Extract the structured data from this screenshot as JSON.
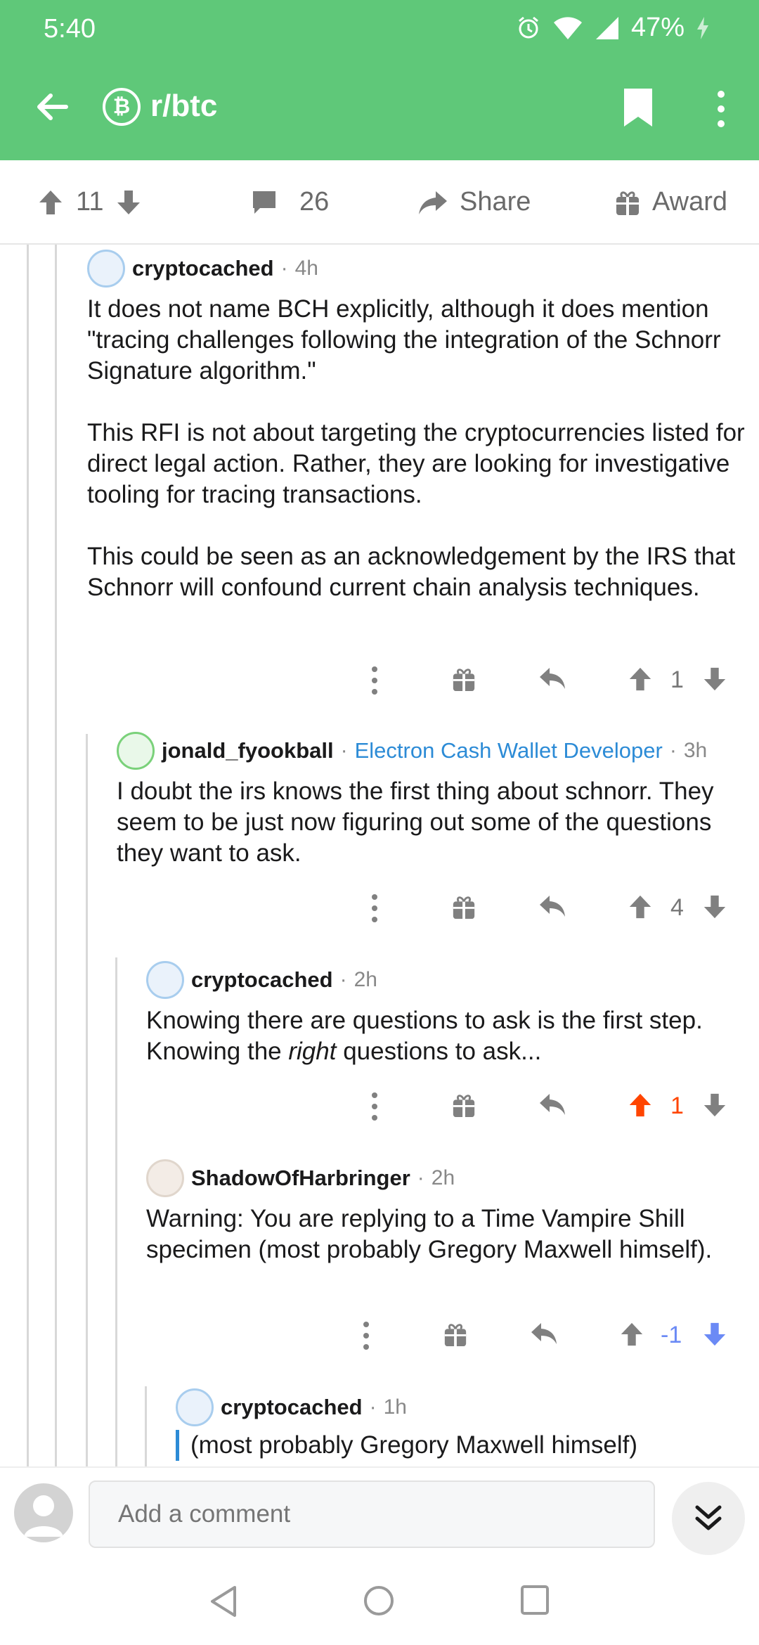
{
  "status": {
    "time": "5:40",
    "battery": "47%"
  },
  "app": {
    "subreddit": "r/btc",
    "sub_icon": "₿"
  },
  "post_actions": {
    "score": "11",
    "comments": "26",
    "share": "Share",
    "award": "Award"
  },
  "comments": [
    {
      "user": "cryptocached",
      "age": "4h",
      "paragraphs": [
        "It does not name BCH explicitly, although it does mention \"tracing challenges following the integration of the Schnorr Signature algorithm.\"",
        "This RFI is not about targeting the cryptocurrencies listed for direct legal action. Rather, they are looking for investigative tooling for tracing transactions.",
        "This could be seen as an acknowledgement by the IRS that Schnorr will confound current chain analysis techniques."
      ],
      "score": "1"
    },
    {
      "user": "jonald_fyookball",
      "flair": "Electron Cash Wallet Developer",
      "age": "3h",
      "paragraphs": [
        "I doubt the irs knows the first thing about schnorr. They seem to be just now figuring out some of the questions they want to ask."
      ],
      "score": "4"
    },
    {
      "user": "cryptocached",
      "age": "2h",
      "text_before": "Knowing there are questions to ask is the first step. Knowing the ",
      "text_italic": "right",
      "text_after": " questions to ask...",
      "score": "1"
    },
    {
      "user": "ShadowOfHarbringer",
      "age": "2h",
      "paragraphs": [
        "Warning: You are replying to a Time Vampire Shill specimen (most probably Gregory Maxwell himself)."
      ],
      "score": "-1"
    },
    {
      "user": "cryptocached",
      "age": "1h",
      "quote": "(most probably Gregory Maxwell himself)"
    }
  ],
  "input": {
    "placeholder": "Add a comment"
  },
  "colors": {
    "brand": "#5fc879",
    "upvote": "#ff4500",
    "downvote": "#6b8af5",
    "flair": "#2c8bd6"
  }
}
